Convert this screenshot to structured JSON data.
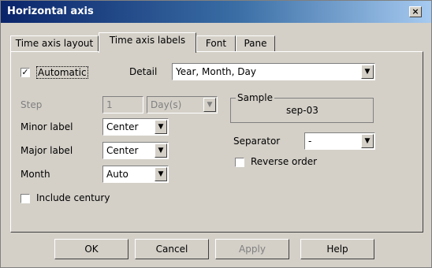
{
  "window": {
    "title": "Horizontal axis",
    "close": "×"
  },
  "tabs": [
    "Time axis layout",
    "Time axis labels",
    "Font",
    "Pane"
  ],
  "automatic": {
    "label": "Automatic",
    "checked": true,
    "mark": "✓"
  },
  "detail": {
    "label": "Detail",
    "value": "Year, Month, Day"
  },
  "step": {
    "label": "Step",
    "value": "1",
    "unit": "Day(s)"
  },
  "sample": {
    "label": "Sample",
    "value": "sep-03"
  },
  "minor_label": {
    "label": "Minor label",
    "value": "Center"
  },
  "major_label": {
    "label": "Major label",
    "value": "Center"
  },
  "month": {
    "label": "Month",
    "value": "Auto"
  },
  "separator": {
    "label": "Separator",
    "value": "-"
  },
  "reverse_order": {
    "label": "Reverse order",
    "checked": false
  },
  "include_century": {
    "label": "Include century",
    "checked": false
  },
  "buttons": {
    "ok": "OK",
    "cancel": "Cancel",
    "apply": "Apply",
    "help": "Help"
  },
  "arrow": "▼"
}
